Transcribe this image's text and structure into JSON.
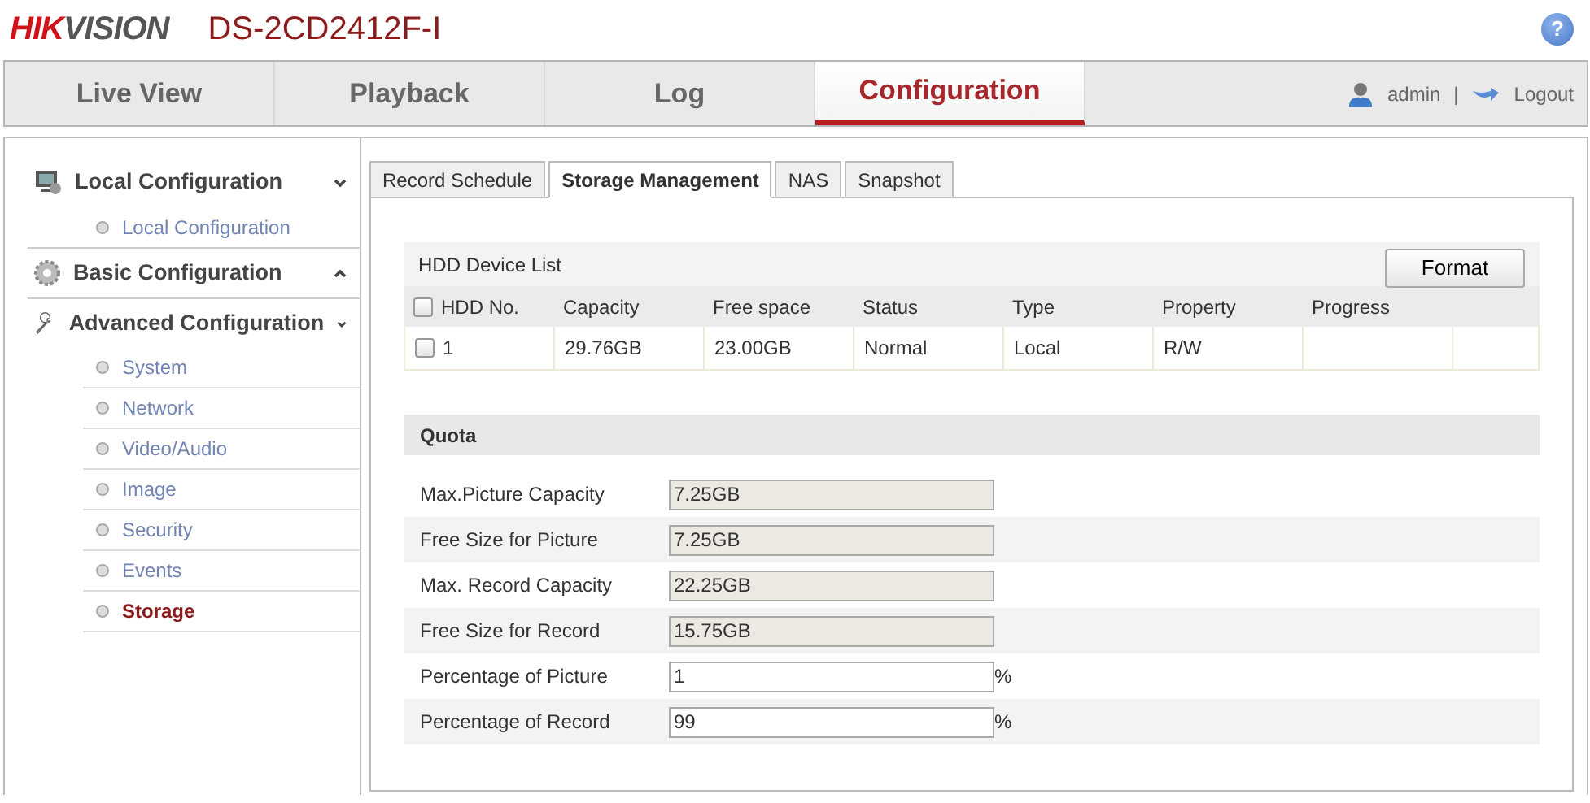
{
  "header": {
    "logo": [
      "HIK",
      "VISION"
    ],
    "model": "DS-2CD2412F-I",
    "help": "?"
  },
  "nav": {
    "tabs": [
      {
        "label": "Live View",
        "selected": false
      },
      {
        "label": "Playback",
        "selected": false
      },
      {
        "label": "Log",
        "selected": false
      },
      {
        "label": "Configuration",
        "selected": true
      }
    ],
    "user": "admin",
    "separator": "|",
    "logout": "Logout"
  },
  "sidebar": [
    {
      "label": "Local Configuration",
      "expanded": true,
      "children": [
        {
          "label": "Local Configuration",
          "selected": false
        }
      ]
    },
    {
      "label": "Basic Configuration",
      "expanded": false
    },
    {
      "label": "Advanced Configuration",
      "expanded": true,
      "children": [
        {
          "label": "System",
          "selected": false
        },
        {
          "label": "Network",
          "selected": false
        },
        {
          "label": "Video/Audio",
          "selected": false
        },
        {
          "label": "Image",
          "selected": false
        },
        {
          "label": "Security",
          "selected": false
        },
        {
          "label": "Events",
          "selected": false
        },
        {
          "label": "Storage",
          "selected": true
        }
      ]
    }
  ],
  "subtabs": [
    {
      "label": "Record Schedule",
      "selected": false
    },
    {
      "label": "Storage Management",
      "selected": true
    },
    {
      "label": "NAS",
      "selected": false
    },
    {
      "label": "Snapshot",
      "selected": false
    }
  ],
  "hdd": {
    "title": "HDD Device List",
    "format_button": "Format",
    "select_all_checked": false,
    "columns": [
      "HDD No.",
      "Capacity",
      "Free space",
      "Status",
      "Type",
      "Property",
      "Progress"
    ],
    "rows": [
      {
        "checked": false,
        "cells": [
          "1",
          "29.76GB",
          "23.00GB",
          "Normal",
          "Local",
          "R/W",
          ""
        ]
      }
    ]
  },
  "quota": {
    "title": "Quota",
    "fields": [
      {
        "label": "Max.Picture Capacity",
        "value": "7.25GB",
        "disabled": true
      },
      {
        "label": "Free Size for Picture",
        "value": "7.25GB",
        "disabled": true
      },
      {
        "label": "Max. Record Capacity",
        "value": "22.25GB",
        "disabled": true
      },
      {
        "label": "Free Size for Record",
        "value": "15.75GB",
        "disabled": true
      },
      {
        "label": "Percentage of Picture",
        "value": "1",
        "disabled": false,
        "unit": "%"
      },
      {
        "label": "Percentage of Record",
        "value": "99",
        "disabled": false,
        "unit": "%"
      }
    ]
  }
}
